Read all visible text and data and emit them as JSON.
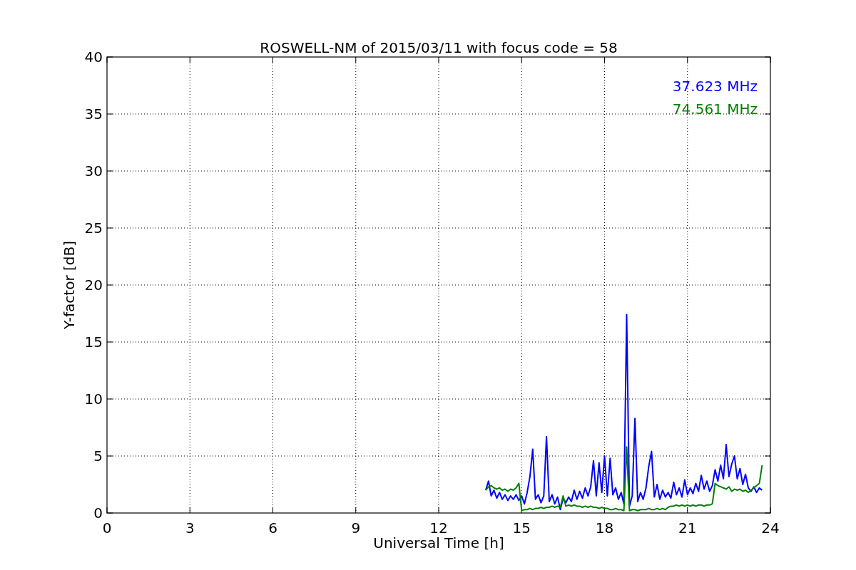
{
  "chart_data": {
    "type": "line",
    "title": "ROSWELL-NM of 2015/03/11 with focus code = 58",
    "xlabel": "Universal Time [h]",
    "ylabel": "Y-factor [dB]",
    "x": [
      13.7,
      13.8,
      13.9,
      14.0,
      14.1,
      14.2,
      14.3,
      14.4,
      14.5,
      14.6,
      14.7,
      14.8,
      14.9,
      15.0,
      15.1,
      15.2,
      15.3,
      15.4,
      15.5,
      15.6,
      15.7,
      15.8,
      15.9,
      16.0,
      16.1,
      16.2,
      16.3,
      16.4,
      16.5,
      16.6,
      16.7,
      16.8,
      16.9,
      17.0,
      17.1,
      17.2,
      17.3,
      17.4,
      17.5,
      17.6,
      17.7,
      17.8,
      17.9,
      18.0,
      18.1,
      18.2,
      18.3,
      18.4,
      18.5,
      18.6,
      18.7,
      18.8,
      18.9,
      19.0,
      19.1,
      19.2,
      19.3,
      19.4,
      19.5,
      19.6,
      19.7,
      19.8,
      19.9,
      20.0,
      20.1,
      20.2,
      20.3,
      20.4,
      20.5,
      20.6,
      20.7,
      20.8,
      20.9,
      21.0,
      21.1,
      21.2,
      21.3,
      21.4,
      21.5,
      21.6,
      21.7,
      21.8,
      21.9,
      22.0,
      22.1,
      22.2,
      22.3,
      22.4,
      22.5,
      22.6,
      22.7,
      22.8,
      22.9,
      23.0,
      23.1,
      23.2,
      23.3,
      23.4,
      23.5,
      23.6,
      23.7
    ],
    "series": [
      {
        "name": "37.623 MHz",
        "color": "#0000ff",
        "values": [
          2,
          2.8,
          1.5,
          2,
          1.3,
          1.8,
          1.2,
          1.6,
          1.1,
          1.5,
          1.2,
          1.6,
          1.1,
          1.5,
          0.8,
          1.8,
          3.2,
          5.6,
          1.2,
          1.6,
          0.9,
          1.5,
          6.7,
          1,
          1.6,
          0.8,
          1.4,
          0.3,
          1.3,
          0.9,
          1.4,
          1.0,
          2,
          1.2,
          1.9,
          1.3,
          2.2,
          1.5,
          2.3,
          4.6,
          1.5,
          4.4,
          1.8,
          5,
          1.5,
          4.8,
          1.6,
          2.2,
          1.2,
          1.8,
          0.8,
          17.4,
          0.6,
          1.5,
          8.3,
          1.0,
          1.8,
          1.2,
          2.2,
          4.1,
          5.4,
          1.4,
          2.5,
          1.2,
          2,
          1.4,
          1.8,
          1.3,
          2.7,
          1.6,
          2.2,
          1.4,
          2.9,
          1.6,
          2.2,
          1.7,
          2.6,
          1.9,
          3.3,
          2.1,
          2.8,
          1.9,
          2.4,
          3.8,
          2.8,
          4.2,
          3,
          6,
          3.2,
          4.3,
          5,
          3,
          3.9,
          2.5,
          3.4,
          2.2,
          1.9,
          2.3,
          1.8,
          2.2,
          2.0
        ]
      },
      {
        "name": "74.561 MHz",
        "color": "#008000",
        "values": [
          2,
          2.3,
          2.4,
          2.2,
          2.1,
          2.2,
          2.0,
          2.1,
          1.9,
          2.1,
          2.0,
          2.2,
          2.6,
          0.2,
          0.3,
          0.3,
          0.4,
          0.3,
          0.4,
          0.4,
          0.5,
          0.4,
          0.5,
          0.5,
          0.6,
          0.5,
          0.6,
          0.5,
          1.5,
          0.6,
          0.7,
          0.6,
          0.7,
          0.6,
          0.6,
          0.5,
          0.6,
          0.5,
          0.6,
          0.5,
          0.5,
          0.4,
          0.5,
          0.4,
          0.4,
          0.3,
          0.3,
          0.4,
          0.3,
          0.3,
          0.2,
          5.8,
          0.2,
          0.3,
          0.3,
          0.2,
          0.3,
          0.3,
          0.3,
          0.4,
          0.3,
          0.3,
          0.4,
          0.3,
          0.4,
          0.3,
          0.5,
          0.6,
          0.6,
          0.7,
          0.6,
          0.7,
          0.6,
          0.7,
          0.6,
          0.7,
          0.6,
          0.7,
          0.7,
          0.6,
          0.7,
          0.7,
          0.8,
          2.6,
          2.4,
          2.3,
          2.2,
          2.1,
          2.3,
          1.9,
          2.1,
          2.0,
          2.1,
          1.9,
          2.0,
          1.8,
          2.0,
          2.2,
          2.4,
          2.6,
          4.2
        ]
      }
    ],
    "grid": true,
    "xlim": [
      0,
      24
    ],
    "ylim": [
      0,
      40
    ],
    "xticks": [
      0,
      3,
      6,
      9,
      12,
      15,
      18,
      21,
      24
    ],
    "yticks": [
      0,
      5,
      10,
      15,
      20,
      25,
      30,
      35,
      40
    ]
  }
}
